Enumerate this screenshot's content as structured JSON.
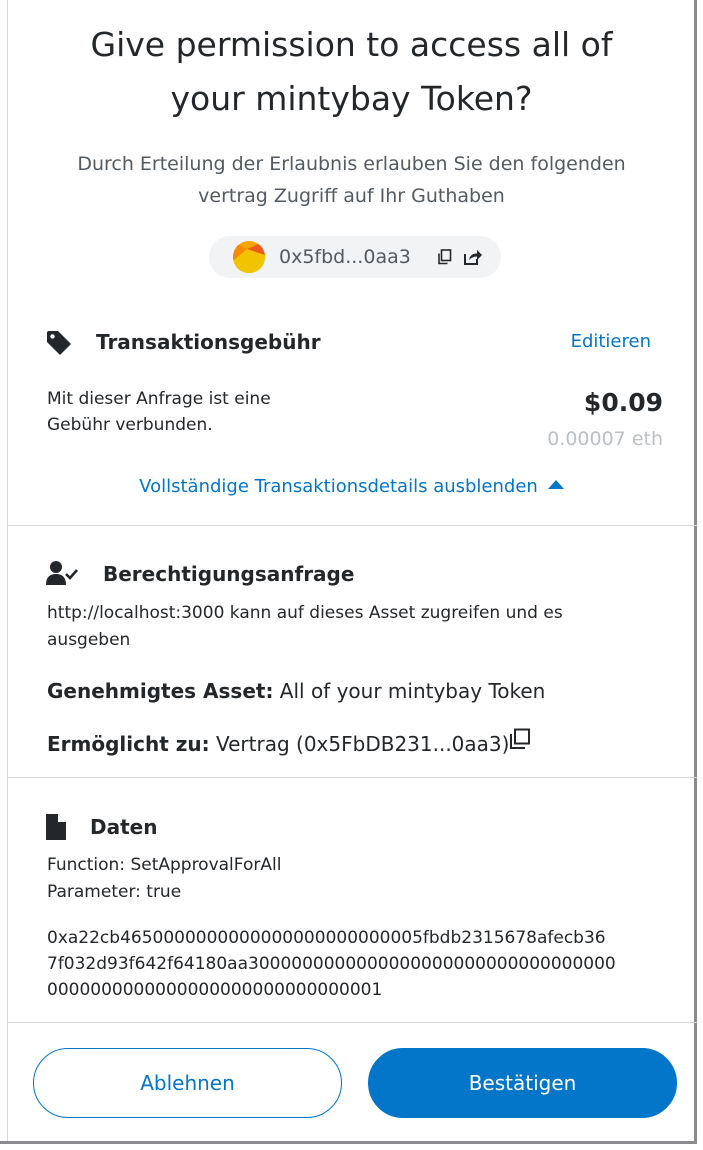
{
  "header": {
    "title_line1": "Give permission to access all of",
    "title_line2": "your mintybay Token?",
    "subtitle_line1": "Durch Erteilung der Erlaubnis erlauben Sie den folgenden",
    "subtitle_line2": "vertrag Zugriff auf Ihr Guthaben"
  },
  "address_pill": {
    "address": "0x5fbd...0aa3",
    "copy_icon": "copy-icon",
    "share_icon": "share-icon"
  },
  "fee": {
    "icon": "tag-icon",
    "title": "Transaktionsgebühr",
    "edit_label": "Editieren",
    "description_line1": "Mit dieser Anfrage ist eine",
    "description_line2": "Gebühr verbunden.",
    "usd": "$0.09",
    "eth": "0.00007 eth",
    "toggle_label": "Vollständige Transaktionsdetails ausblenden"
  },
  "permission": {
    "icon": "user-check-icon",
    "title": "Berechtigungsanfrage",
    "description_line1": "http://localhost:3000 kann auf dieses Asset zugreifen und es",
    "description_line2": "ausgeben",
    "approved_asset_label": "Genehmigtes Asset:",
    "approved_asset_value": "All of your mintybay Token",
    "granted_to_label": "Ermöglicht zu:",
    "granted_to_value": "Vertrag (0x5FbDB231...0aa3)"
  },
  "data": {
    "icon": "file-icon",
    "title": "Daten",
    "function_line": "Function: SetApprovalForAll",
    "parameter_line": "Parameter: true",
    "hex_line1": "0xa22cb4650000000000000000000000005fbdb2315678afecb36",
    "hex_line2": "7f032d93f642f64180aa3000000000000000000000000000000000",
    "hex_line3": "0000000000000000000000000000001"
  },
  "buttons": {
    "reject": "Ablehnen",
    "confirm": "Bestätigen"
  },
  "colors": {
    "accent": "#0376c9",
    "text": "#24272a",
    "muted": "#535a61",
    "faint": "#bbc0c5"
  }
}
